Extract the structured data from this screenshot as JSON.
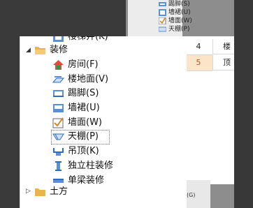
{
  "background_tree": {
    "items": [
      {
        "label": "踢脚(S)"
      },
      {
        "label": "墙裙(U)"
      },
      {
        "label": "墙面(W)"
      },
      {
        "label": "天棚(P)"
      }
    ]
  },
  "background_table": {
    "rows": [
      {
        "index": "4",
        "value": "楼"
      },
      {
        "index": "5",
        "value": "顶"
      }
    ]
  },
  "background_bottom": {
    "label": "栏杆扶手(G)"
  },
  "popup_tree": {
    "clipped_top": "楼梯井(K)",
    "groups": [
      {
        "label": "装修",
        "expanded": true,
        "items": [
          {
            "label": "房间(F)",
            "icon": "house-icon"
          },
          {
            "label": "楼地面(V)",
            "icon": "floor-icon"
          },
          {
            "label": "踢脚(S)",
            "icon": "skirting-icon"
          },
          {
            "label": "墙裙(U)",
            "icon": "wall-skirt-icon"
          },
          {
            "label": "墙面(W)",
            "icon": "wall-face-icon"
          },
          {
            "label": "天棚(P)",
            "icon": "ceiling-icon",
            "selected": true
          },
          {
            "label": "吊顶(K)",
            "icon": "suspended-ceiling-icon"
          },
          {
            "label": "独立柱装修",
            "icon": "column-icon"
          },
          {
            "label": "单梁装修",
            "icon": "beam-icon"
          }
        ]
      },
      {
        "label": "土方",
        "expanded": false,
        "items": []
      }
    ]
  },
  "colors": {
    "folder": "#e8b54a",
    "selection_bg": "#fbe5c8",
    "selection_text": "#c0561e"
  }
}
